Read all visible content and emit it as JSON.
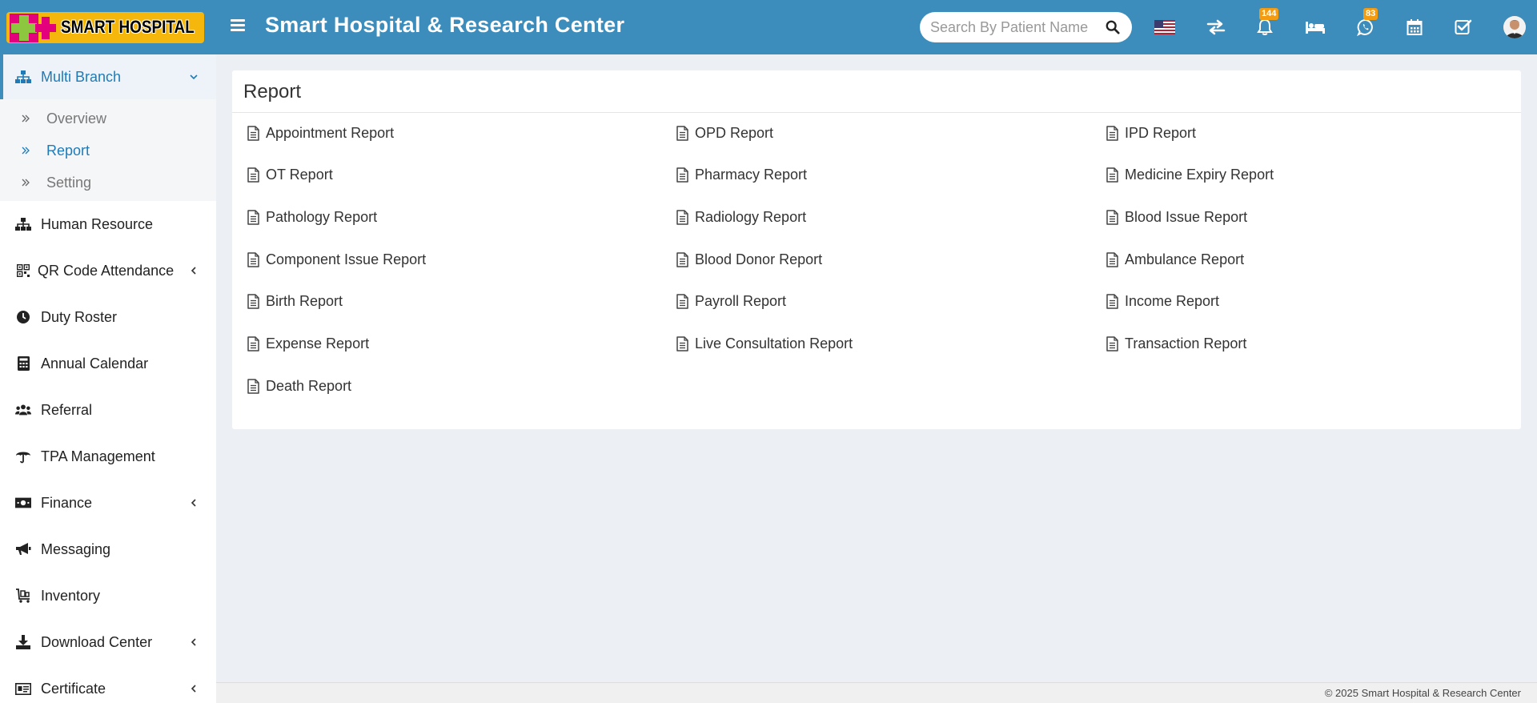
{
  "header": {
    "logo_text": "SMART HOSPITAL",
    "title": "Smart Hospital & Research Center",
    "search_placeholder": "Search By Patient Name",
    "notification_count": "144",
    "whatsapp_count": "83",
    "icons": [
      "menu-icon",
      "flag-us-icon",
      "transfer-icon",
      "bell-icon",
      "bed-icon",
      "whatsapp-icon",
      "calendar-icon",
      "task-check-icon",
      "user-avatar"
    ]
  },
  "sidebar": {
    "active_menu": {
      "label": "Multi Branch",
      "icon": "sitemap-icon"
    },
    "submenu": [
      {
        "label": "Overview"
      },
      {
        "label": "Report"
      },
      {
        "label": "Setting"
      }
    ],
    "items": [
      {
        "label": "Human Resource",
        "icon": "sitemap-icon",
        "has_children": false
      },
      {
        "label": "QR Code Attendance",
        "icon": "qrcode-icon",
        "has_children": true
      },
      {
        "label": "Duty Roster",
        "icon": "clock-icon",
        "has_children": false
      },
      {
        "label": "Annual Calendar",
        "icon": "calculator-icon",
        "has_children": false
      },
      {
        "label": "Referral",
        "icon": "users-icon",
        "has_children": false
      },
      {
        "label": "TPA Management",
        "icon": "umbrella-icon",
        "has_children": false
      },
      {
        "label": "Finance",
        "icon": "money-icon",
        "has_children": true
      },
      {
        "label": "Messaging",
        "icon": "bullhorn-icon",
        "has_children": false
      },
      {
        "label": "Inventory",
        "icon": "cart-icon",
        "has_children": false
      },
      {
        "label": "Download Center",
        "icon": "download-icon",
        "has_children": true
      },
      {
        "label": "Certificate",
        "icon": "certificate-icon",
        "has_children": true
      }
    ]
  },
  "main": {
    "title": "Report",
    "reports": [
      [
        "Appointment Report",
        "OPD Report",
        "IPD Report"
      ],
      [
        "OT Report",
        "Pharmacy Report",
        "Medicine Expiry Report"
      ],
      [
        "Pathology Report",
        "Radiology Report",
        "Blood Issue Report"
      ],
      [
        "Component Issue Report",
        "Blood Donor Report",
        "Ambulance Report"
      ],
      [
        "Birth Report",
        "Payroll Report",
        "Income Report"
      ],
      [
        "Expense Report",
        "Live Consultation Report",
        "Transaction Report"
      ],
      [
        "Death Report"
      ]
    ]
  },
  "footer": {
    "text": "© 2025 Smart Hospital & Research Center"
  },
  "colors": {
    "header_bg": "#3c8dbc",
    "accent": "#1e7bb8",
    "badge": "#f39c12",
    "page_bg": "#ecf0f5"
  }
}
